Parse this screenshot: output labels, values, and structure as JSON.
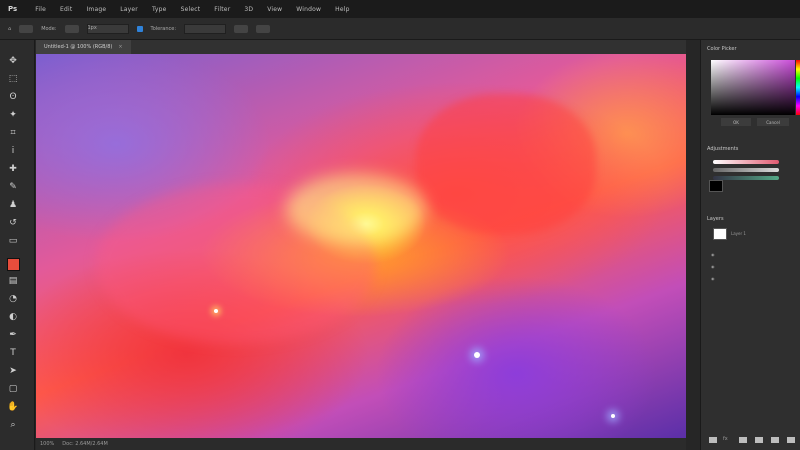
{
  "menubar": {
    "logo": "Ps",
    "items": [
      "File",
      "Edit",
      "Image",
      "Layer",
      "Type",
      "Select",
      "Filter",
      "3D",
      "View",
      "Window",
      "Help"
    ]
  },
  "options_bar": {
    "mode_label": "Mode:",
    "size_value": "1px",
    "tolerance_label": "Tolerance:"
  },
  "document": {
    "tab_label": "Untitled-1 @ 100% (RGB/8)",
    "close_glyph": "×",
    "status_zoom": "100%",
    "status_doc": "Doc: 2.64M/2.64M"
  },
  "colors": {
    "foreground": "#e74d3c",
    "picker_hue": "#c94bd8"
  },
  "panels": {
    "color_title": "Color Picker",
    "btn_ok": "OK",
    "btn_cancel": "Cancel",
    "adjust_title": "Adjustments",
    "layers_title": "Layers",
    "layer_name": "Layer 1",
    "fx_label": "fx"
  },
  "tools": [
    "move-icon",
    "marquee-icon",
    "lasso-icon",
    "magic-wand-icon",
    "crop-icon",
    "eyedropper-icon",
    "healing-brush-icon",
    "brush-icon",
    "clone-stamp-icon",
    "history-brush-icon",
    "eraser-icon",
    "gradient-icon",
    "blur-icon",
    "dodge-icon",
    "pen-icon",
    "type-icon",
    "path-select-icon",
    "shape-icon",
    "hand-icon",
    "zoom-icon"
  ]
}
